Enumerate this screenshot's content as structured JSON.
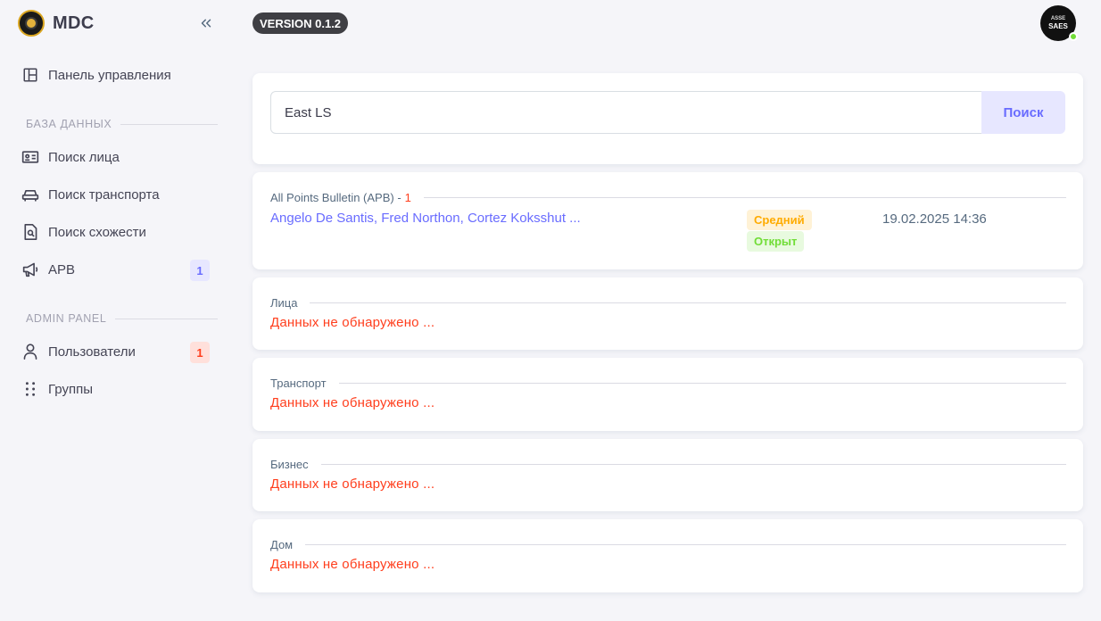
{
  "app": {
    "title": "MDC",
    "version": "VERSION 0.1.2"
  },
  "sidebar": {
    "dashboard": {
      "label": "Панель управления",
      "icon": "layout-icon"
    },
    "database_header": "БАЗА ДАННЫХ",
    "database_items": [
      {
        "label": "Поиск лица",
        "icon": "id-card-icon"
      },
      {
        "label": "Поиск транспорта",
        "icon": "car-icon"
      },
      {
        "label": "Поиск схожести",
        "icon": "file-search-icon"
      },
      {
        "label": "APB",
        "icon": "megaphone-icon",
        "badge": "1"
      }
    ],
    "admin_header": "ADMIN PANEL",
    "admin_items": [
      {
        "label": "Пользователи",
        "icon": "user-icon",
        "badge": "1"
      },
      {
        "label": "Группы",
        "icon": "dots-grid-icon"
      }
    ]
  },
  "user": {
    "avatar_line1": "ASSE",
    "avatar_line2": "SAES",
    "status": "online"
  },
  "search": {
    "value": "East LS",
    "button_label": "Поиск"
  },
  "results": {
    "apb": {
      "title": "All Points Bulletin (APB) -",
      "count": "1",
      "names": "Angelo De Santis, Fred Northon, Cortez Koksshut ...",
      "priority": "Средний",
      "status": "Открыт",
      "date": "19.02.2025 14:36"
    },
    "persons": {
      "title": "Лица",
      "empty": "Данных не обнаружено ..."
    },
    "vehicles": {
      "title": "Транспорт",
      "empty": "Данных не обнаружено ..."
    },
    "business": {
      "title": "Бизнес",
      "empty": "Данных не обнаружено ..."
    },
    "house": {
      "title": "Дом",
      "empty": "Данных не обнаружено ..."
    }
  },
  "colors": {
    "accent": "#696cff",
    "danger": "#ff3e1d",
    "warning": "#ffab00",
    "success": "#71dd37",
    "background": "#f5f5f9"
  }
}
